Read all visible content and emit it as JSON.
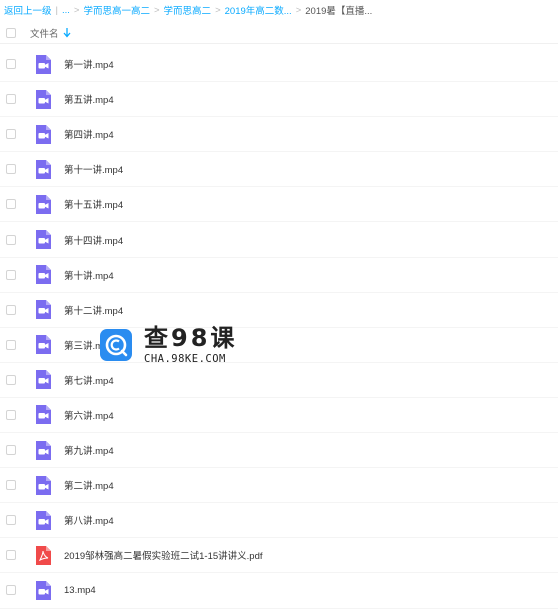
{
  "breadcrumb": {
    "back": "返回上一级",
    "ellipsis": "...",
    "items": [
      "学而思高一高二",
      "学而思高二",
      "2019年高二数..."
    ],
    "current": "2019暑【直播..."
  },
  "header": {
    "column_name": "文件名"
  },
  "files": [
    {
      "name": "第一讲.mp4",
      "type": "video"
    },
    {
      "name": "第五讲.mp4",
      "type": "video"
    },
    {
      "name": "第四讲.mp4",
      "type": "video"
    },
    {
      "name": "第十一讲.mp4",
      "type": "video"
    },
    {
      "name": "第十五讲.mp4",
      "type": "video"
    },
    {
      "name": "第十四讲.mp4",
      "type": "video"
    },
    {
      "name": "第十讲.mp4",
      "type": "video"
    },
    {
      "name": "第十二讲.mp4",
      "type": "video"
    },
    {
      "name": "第三讲.mp4",
      "type": "video"
    },
    {
      "name": "第七讲.mp4",
      "type": "video"
    },
    {
      "name": "第六讲.mp4",
      "type": "video"
    },
    {
      "name": "第九讲.mp4",
      "type": "video"
    },
    {
      "name": "第二讲.mp4",
      "type": "video"
    },
    {
      "name": "第八讲.mp4",
      "type": "video"
    },
    {
      "name": "2019邹林强高二暑假实验班二试1-15讲讲义.pdf",
      "type": "pdf"
    },
    {
      "name": "13.mp4",
      "type": "video"
    }
  ],
  "watermark": {
    "title": "查98课",
    "url": "CHA.98KE.COM"
  },
  "colors": {
    "link": "#09aaff",
    "video_icon": "#7b6cf0",
    "pdf_icon": "#f04a4a"
  },
  "icons": {
    "sort": "arrow-down-icon",
    "video": "video-file-icon",
    "pdf": "pdf-file-icon"
  }
}
